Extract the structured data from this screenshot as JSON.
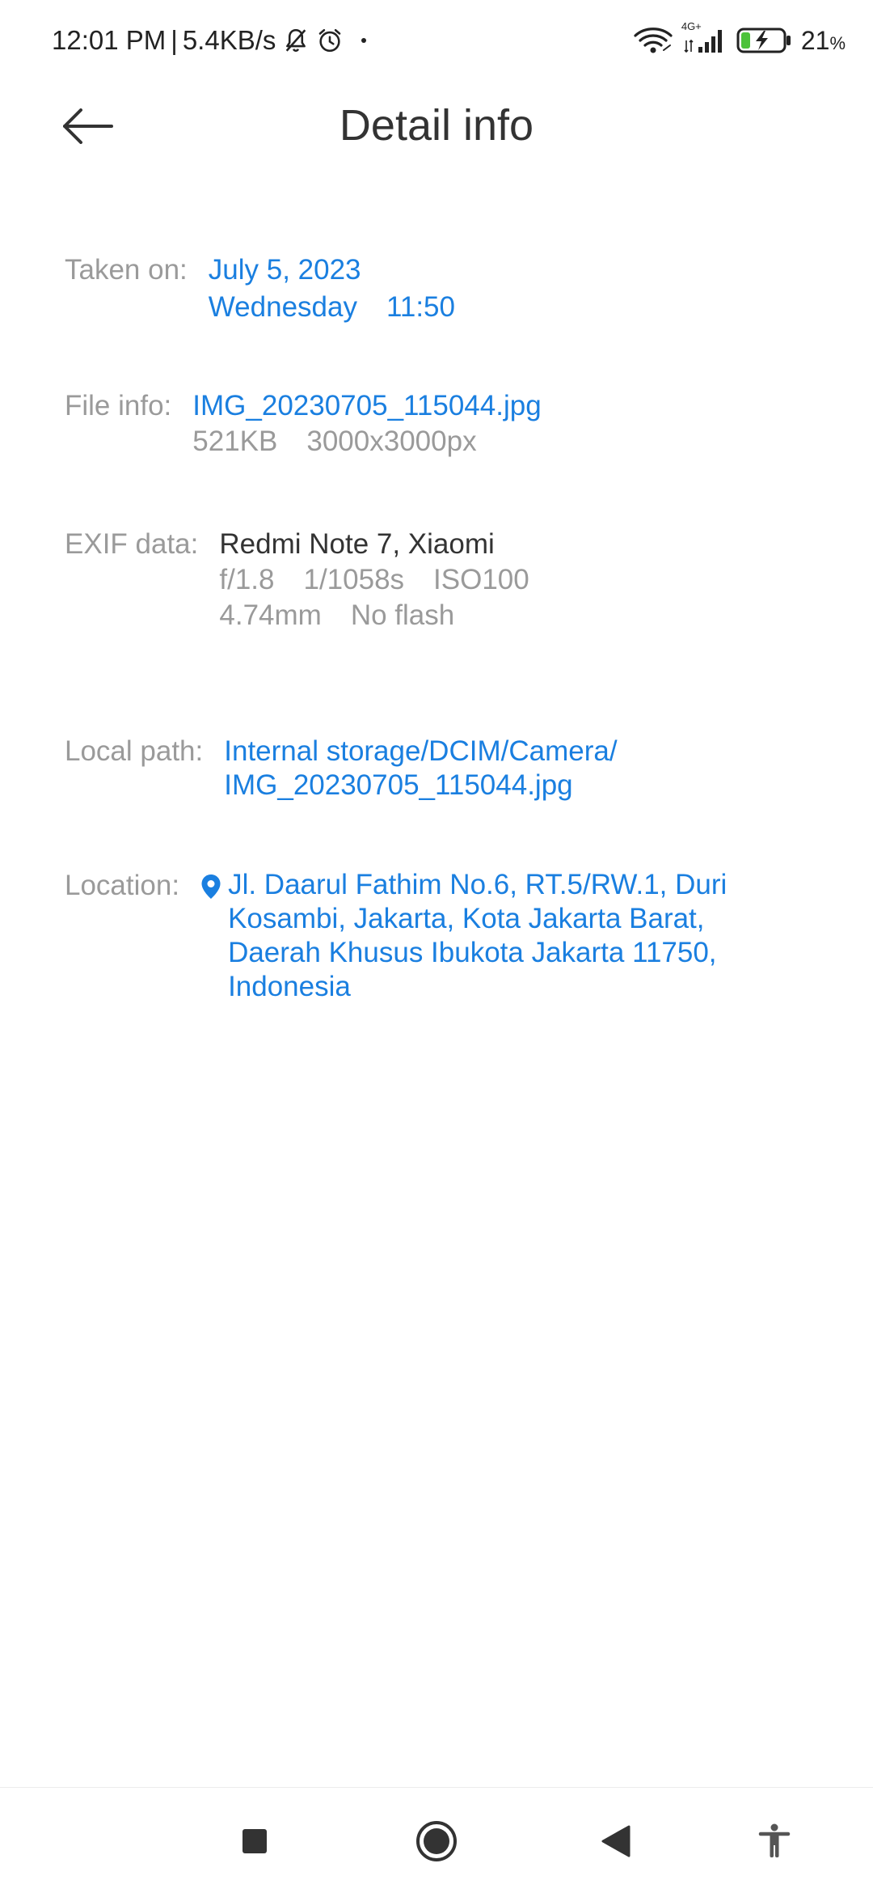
{
  "status_bar": {
    "time": "12:01 PM",
    "separator": "|",
    "net_speed": "5.4KB/s",
    "network_type": "4G+",
    "battery_percent": "21",
    "battery_unit": "%",
    "battery_level": 0.21,
    "icons": [
      "bell-off-icon",
      "alarm-icon",
      "wifi-icon",
      "signal-icon",
      "battery-charging-icon"
    ]
  },
  "header": {
    "title": "Detail info",
    "back_icon": "arrow-left-icon"
  },
  "details": {
    "taken_on": {
      "label": "Taken on:",
      "date": "July 5, 2023",
      "weekday": "Wednesday",
      "time": "11:50"
    },
    "file_info": {
      "label": "File info:",
      "file_name": "IMG_20230705_115044.jpg",
      "size": "521KB",
      "resolution": "3000x3000px"
    },
    "exif": {
      "label": "EXIF data:",
      "device": "Redmi Note 7, Xiaomi",
      "aperture": "f/1.8",
      "shutter": "1/1058s",
      "iso": "ISO100",
      "focal_length": "4.74mm",
      "flash": "No flash"
    },
    "local_path": {
      "label": "Local path:",
      "line1": "Internal storage/DCIM/Camera/",
      "line2": "IMG_20230705_115044.jpg"
    },
    "location": {
      "label": "Location:",
      "address": "Jl. Daarul Fathim No.6, RT.5/RW.1, Duri Kosambi, Jakarta, Kota Jakarta Barat, Daerah Khusus Ibukota Jakarta 11750, Indonesia",
      "icon": "location-pin-icon"
    }
  },
  "colors": {
    "accent": "#1a7fe0",
    "label": "#9a9a9a",
    "text": "#333333",
    "battery_fill": "#4cc23a"
  },
  "nav_bar": {
    "icons": [
      "recents-square-icon",
      "home-circle-icon",
      "back-triangle-icon",
      "accessibility-icon"
    ]
  }
}
